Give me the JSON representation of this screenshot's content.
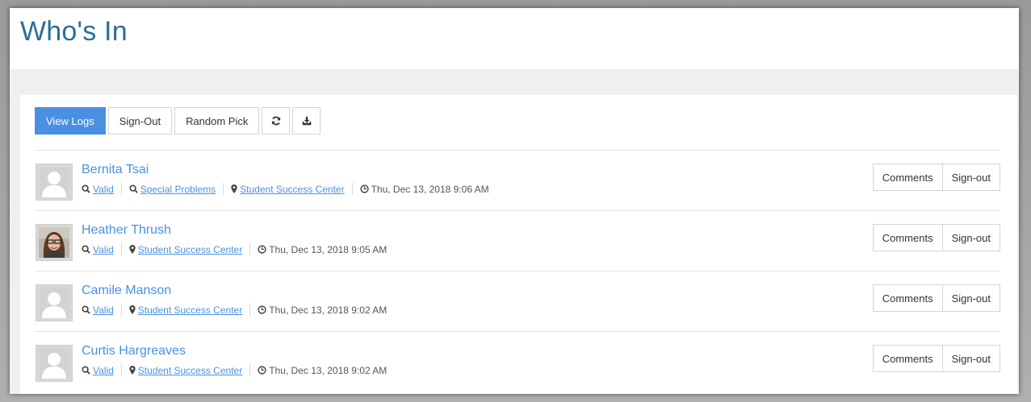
{
  "page": {
    "title": "Who's In"
  },
  "toolbar": {
    "view_logs": "View Logs",
    "sign_out": "Sign-Out",
    "random_pick": "Random Pick",
    "refresh_icon": "refresh-icon",
    "download_icon": "download-icon"
  },
  "rows": [
    {
      "name": "Bernita Tsai",
      "avatar": "placeholder",
      "status": "Valid",
      "reason": "Special Problems",
      "location": "Student Success Center",
      "time": "Thu, Dec 13, 2018 9:06 AM",
      "comments": "Comments",
      "signout": "Sign-out"
    },
    {
      "name": "Heather Thrush",
      "avatar": "photo",
      "status": "Valid",
      "location": "Student Success Center",
      "time": "Thu, Dec 13, 2018 9:05 AM",
      "comments": "Comments",
      "signout": "Sign-out"
    },
    {
      "name": "Camile Manson",
      "avatar": "placeholder",
      "status": "Valid",
      "location": "Student Success Center",
      "time": "Thu, Dec 13, 2018 9:02 AM",
      "comments": "Comments",
      "signout": "Sign-out"
    },
    {
      "name": "Curtis Hargreaves",
      "avatar": "placeholder",
      "status": "Valid",
      "location": "Student Success Center",
      "time": "Thu, Dec 13, 2018 9:02 AM",
      "comments": "Comments",
      "signout": "Sign-out"
    }
  ],
  "colors": {
    "accent": "#4a90e2",
    "title": "#2a6f97"
  }
}
